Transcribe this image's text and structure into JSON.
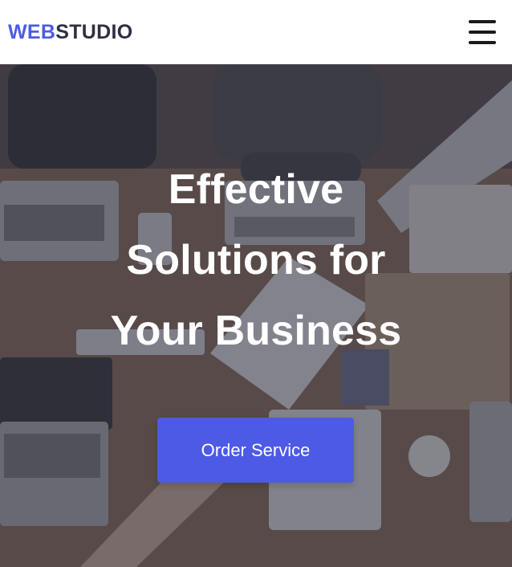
{
  "header": {
    "logo_accent": "WEB",
    "logo_rest": "STUDIO",
    "menu_icon": "hamburger-icon"
  },
  "hero": {
    "title_line1": "Effective",
    "title_line2": "Solutions for",
    "title_line3": "Your Business",
    "cta_label": "Order Service",
    "background": "office-desk-photo"
  },
  "colors": {
    "accent": "#4d5ae5",
    "dark_text": "#2e2f42",
    "overlay": "#2e2f42"
  }
}
